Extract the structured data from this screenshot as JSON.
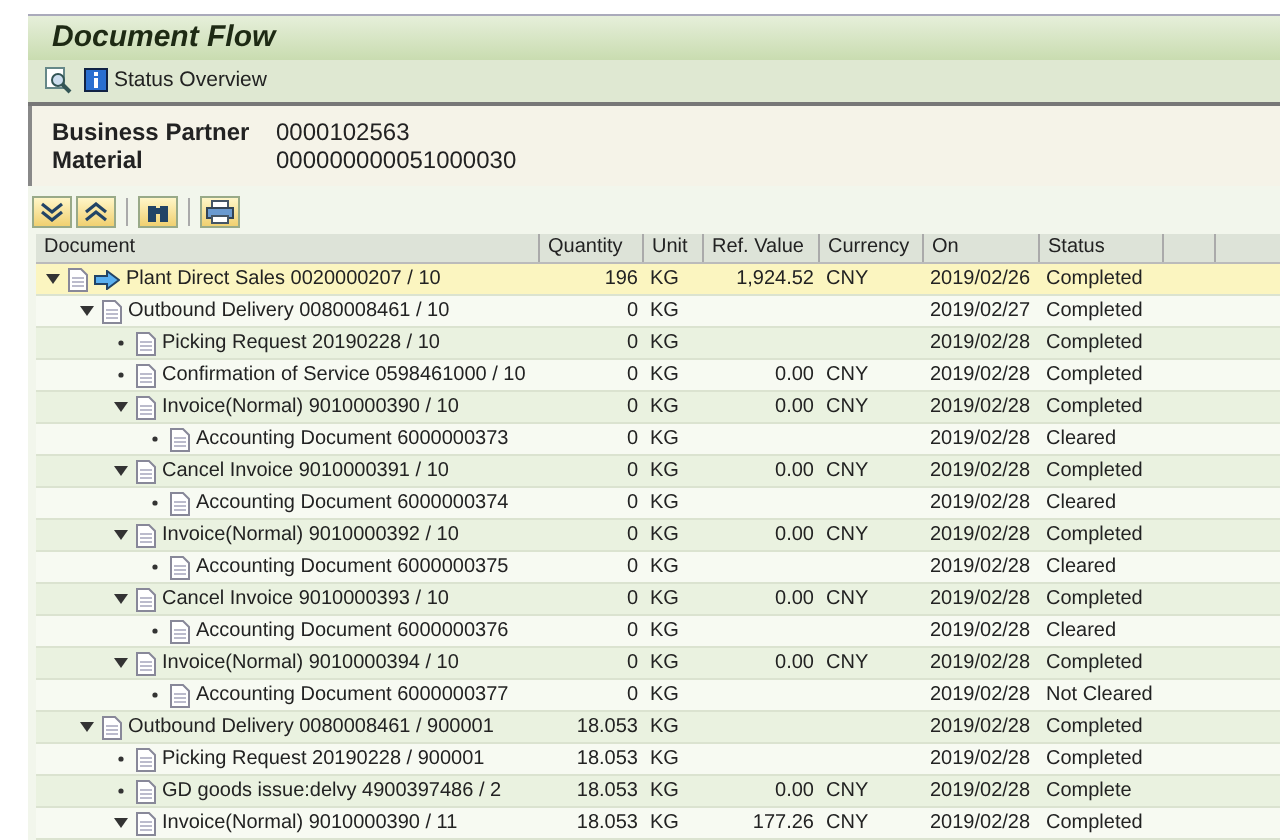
{
  "title": "Document Flow",
  "toolbar": [
    {
      "kind": "find"
    },
    {
      "kind": "info",
      "label": "Status Overview"
    }
  ],
  "header_fields": [
    {
      "label": "Business Partner",
      "value": "0000102563"
    },
    {
      "label": "Material",
      "value": "000000000051000030"
    }
  ],
  "grid_toolbar": [
    {
      "kind": "expand"
    },
    {
      "kind": "collapse"
    },
    {
      "kind": "find"
    },
    {
      "kind": "print"
    }
  ],
  "table": {
    "columns": [
      "Document",
      "Quantity",
      "Unit",
      "Ref. Value",
      "Currency",
      "On",
      "Status"
    ],
    "rows": [
      {
        "document": "Plant Direct Sales 0020000207 / 10",
        "current": true,
        "selected": true,
        "expanded": true,
        "quantity": "196",
        "unit": "KG",
        "ref_value": "1,924.52",
        "currency": "CNY",
        "on": "2019/02/26",
        "status": "Completed",
        "children": [
          {
            "document": "Outbound Delivery 0080008461 / 10",
            "selected": false,
            "expanded": true,
            "quantity": "0",
            "unit": "KG",
            "on": "2019/02/27",
            "status": "Completed",
            "children": [
              {
                "document": "Picking Request 20190228 / 10",
                "selected": false,
                "quantity": "0",
                "unit": "KG",
                "on": "2019/02/28",
                "status": "Completed"
              },
              {
                "document": "Confirmation of Service 0598461000 / 10",
                "selected": false,
                "quantity": "0",
                "unit": "KG",
                "ref_value": "0.00",
                "currency": "CNY",
                "on": "2019/02/28",
                "status": "Completed"
              },
              {
                "document": "Invoice(Normal) 9010000390 / 10",
                "selected": false,
                "expanded": true,
                "quantity": "0",
                "unit": "KG",
                "ref_value": "0.00",
                "currency": "CNY",
                "on": "2019/02/28",
                "status": "Completed",
                "children": [
                  {
                    "document": "Accounting Document 6000000373",
                    "selected": false,
                    "quantity": "0",
                    "unit": "KG",
                    "on": "2019/02/28",
                    "status": "Cleared"
                  }
                ]
              },
              {
                "document": "Cancel Invoice 9010000391 / 10",
                "selected": false,
                "expanded": true,
                "quantity": "0",
                "unit": "KG",
                "ref_value": "0.00",
                "currency": "CNY",
                "on": "2019/02/28",
                "status": "Completed",
                "children": [
                  {
                    "document": "Accounting Document 6000000374",
                    "selected": false,
                    "quantity": "0",
                    "unit": "KG",
                    "on": "2019/02/28",
                    "status": "Cleared"
                  }
                ]
              },
              {
                "document": "Invoice(Normal) 9010000392 / 10",
                "selected": false,
                "expanded": true,
                "quantity": "0",
                "unit": "KG",
                "ref_value": "0.00",
                "currency": "CNY",
                "on": "2019/02/28",
                "status": "Completed",
                "children": [
                  {
                    "document": "Accounting Document 6000000375",
                    "selected": false,
                    "quantity": "0",
                    "unit": "KG",
                    "on": "2019/02/28",
                    "status": "Cleared"
                  }
                ]
              },
              {
                "document": "Cancel Invoice 9010000393 / 10",
                "selected": false,
                "expanded": true,
                "quantity": "0",
                "unit": "KG",
                "ref_value": "0.00",
                "currency": "CNY",
                "on": "2019/02/28",
                "status": "Completed",
                "children": [
                  {
                    "document": "Accounting Document 6000000376",
                    "selected": false,
                    "quantity": "0",
                    "unit": "KG",
                    "on": "2019/02/28",
                    "status": "Cleared"
                  }
                ]
              },
              {
                "document": "Invoice(Normal) 9010000394 / 10",
                "selected": false,
                "expanded": true,
                "quantity": "0",
                "unit": "KG",
                "ref_value": "0.00",
                "currency": "CNY",
                "on": "2019/02/28",
                "status": "Completed",
                "children": [
                  {
                    "document": "Accounting Document 6000000377",
                    "selected": false,
                    "quantity": "0",
                    "unit": "KG",
                    "on": "2019/02/28",
                    "status": "Not Cleared"
                  }
                ]
              }
            ]
          },
          {
            "document": "Outbound Delivery 0080008461 / 900001",
            "selected": false,
            "expanded": true,
            "quantity": "18.053",
            "unit": "KG",
            "on": "2019/02/28",
            "status": "Completed",
            "children": [
              {
                "document": "Picking Request 20190228 / 900001",
                "selected": false,
                "quantity": "18.053",
                "unit": "KG",
                "on": "2019/02/28",
                "status": "Completed"
              },
              {
                "document": "GD goods issue:delvy 4900397486 / 2",
                "selected": false,
                "quantity": "18.053",
                "unit": "KG",
                "ref_value": "0.00",
                "currency": "CNY",
                "on": "2019/02/28",
                "status": "Complete"
              },
              {
                "document": "Invoice(Normal) 9010000390 / 11",
                "selected": false,
                "expanded": true,
                "quantity": "18.053",
                "unit": "KG",
                "ref_value": "177.26",
                "currency": "CNY",
                "on": "2019/02/28",
                "status": "Completed"
              }
            ]
          }
        ]
      }
    ]
  }
}
